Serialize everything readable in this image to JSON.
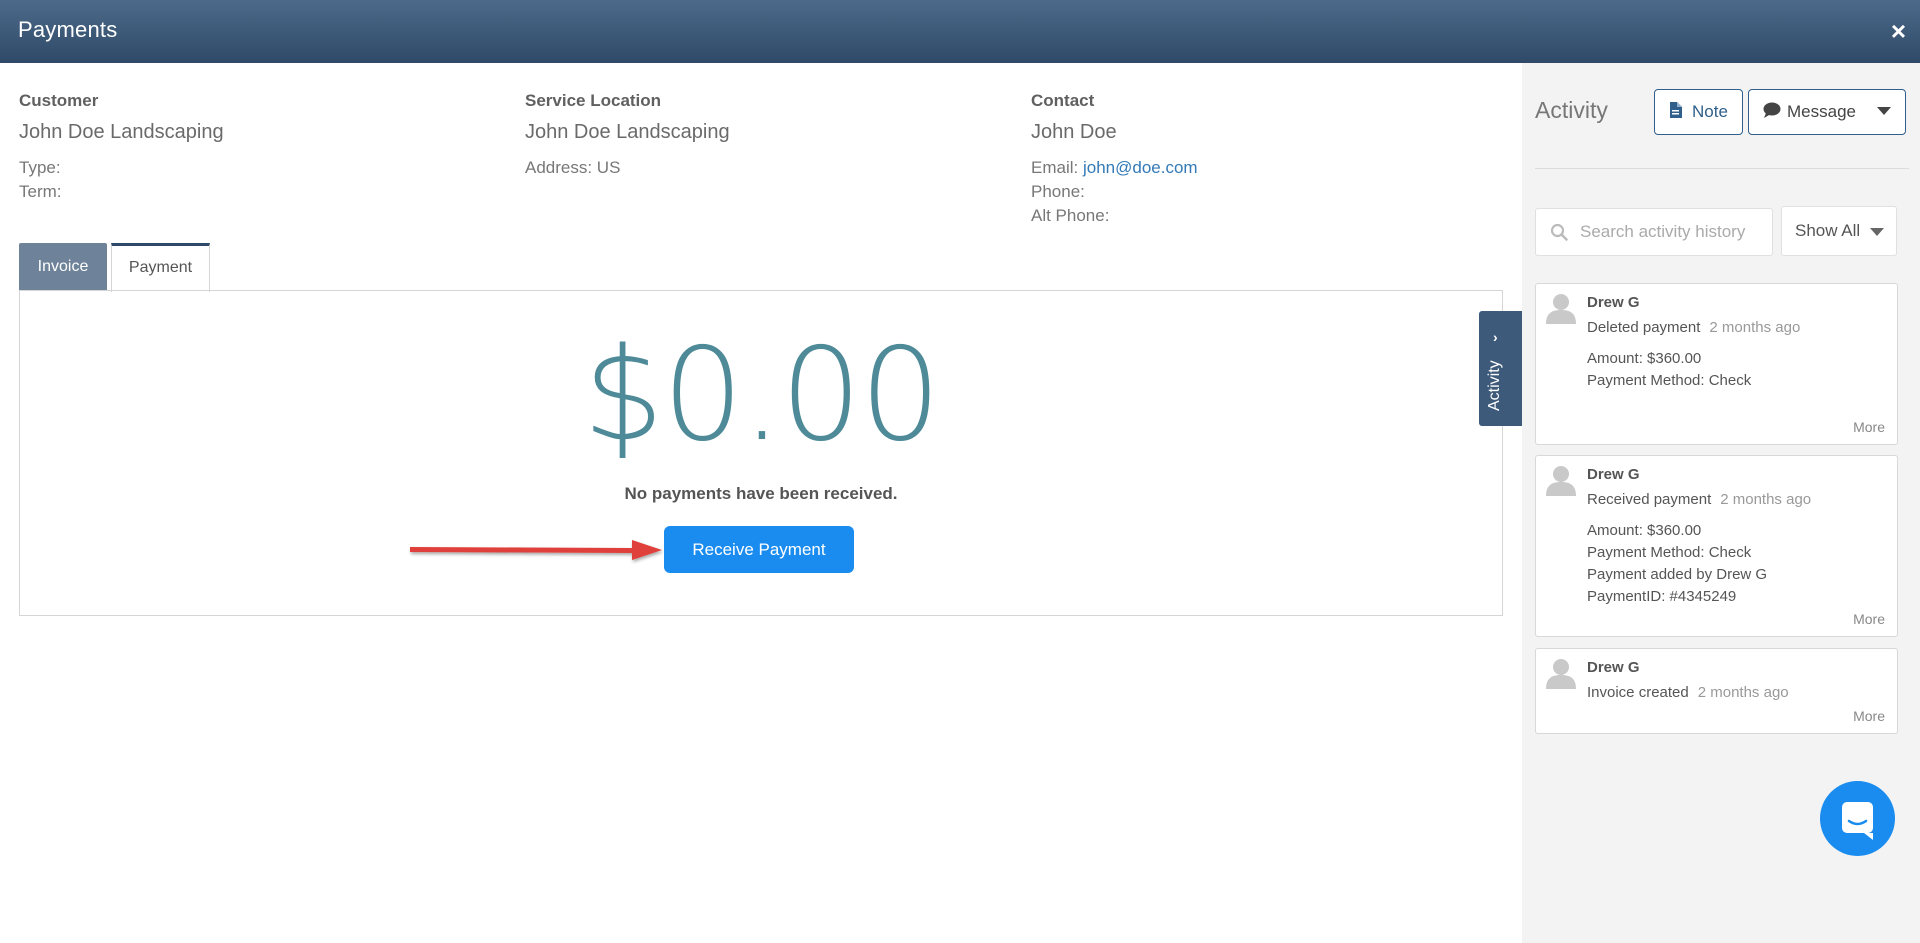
{
  "header": {
    "title": "Payments",
    "close_symbol": "×"
  },
  "customer": {
    "heading": "Customer",
    "name": "John Doe Landscaping",
    "type_label": "Type:",
    "term_label": "Term:"
  },
  "service_location": {
    "heading": "Service Location",
    "name": "John Doe Landscaping",
    "address": "Address: US"
  },
  "contact": {
    "heading": "Contact",
    "name": "John Doe",
    "email_label": "Email:",
    "email": "john@doe.com",
    "phone_label": "Phone:",
    "alt_phone_label": "Alt Phone:"
  },
  "tabs": {
    "invoice": "Invoice",
    "payment": "Payment"
  },
  "payment_panel": {
    "amount": "$0.00",
    "empty_message": "No payments have been received.",
    "receive_button": "Receive Payment"
  },
  "activity_tab": {
    "label": "Activity",
    "chevron": "›"
  },
  "activity": {
    "title": "Activity",
    "note_button": "Note",
    "message_button": "Message",
    "search_placeholder": "Search activity history",
    "filter": "Show All",
    "items": [
      {
        "user": "Drew G",
        "action": "Deleted payment",
        "time": "2 months ago",
        "details": [
          "Amount: $360.00",
          "Payment Method: Check"
        ],
        "more": "More"
      },
      {
        "user": "Drew G",
        "action": "Received payment",
        "time": "2 months ago",
        "details": [
          "Amount: $360.00",
          "Payment Method: Check",
          "Payment added by Drew G",
          "PaymentID: #4345249"
        ],
        "more": "More"
      },
      {
        "user": "Drew G",
        "action": "Invoice created",
        "time": "2 months ago",
        "details": [],
        "more": "More"
      }
    ]
  },
  "colors": {
    "header": "#3d5a7a",
    "amount": "#4e8a98",
    "primary_button": "#1a8cf0",
    "annotation_arrow": "#e0403a"
  },
  "icons": {
    "close": "close-icon",
    "note": "document-icon",
    "message": "chat-bubble-icon",
    "search": "search-icon",
    "avatar": "user-avatar-icon",
    "chat_launcher": "intercom-chat-icon"
  }
}
